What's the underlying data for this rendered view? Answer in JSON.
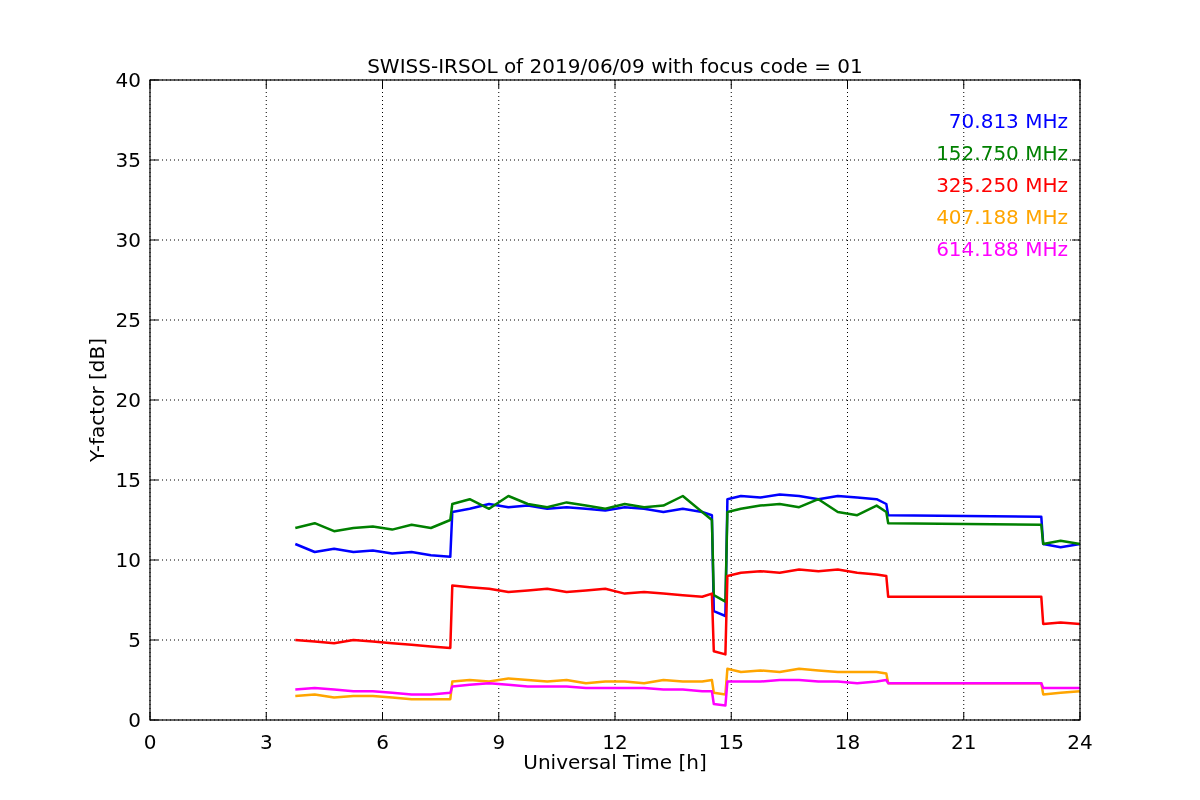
{
  "chart_data": {
    "type": "line",
    "title": "SWISS-IRSOL of 2019/06/09 with focus code = 01",
    "xlabel": "Universal Time [h]",
    "ylabel": "Y-factor [dB]",
    "x": [
      3.75,
      4.25,
      4.75,
      5.25,
      5.75,
      6.25,
      6.75,
      7.25,
      7.75,
      7.8,
      8.25,
      8.75,
      9.25,
      9.75,
      10.25,
      10.75,
      11.25,
      11.75,
      12.25,
      12.75,
      13.25,
      13.75,
      14.25,
      14.5,
      14.55,
      14.85,
      14.9,
      15.25,
      15.75,
      16.25,
      16.75,
      17.25,
      17.75,
      18.25,
      18.75,
      19.0,
      19.05,
      23.0,
      23.05,
      23.5,
      24
    ],
    "series": [
      {
        "name": "70.813 MHz",
        "color": "#0000ff",
        "values": [
          11,
          10.5,
          10.7,
          10.5,
          10.6,
          10.4,
          10.5,
          10.3,
          10.2,
          13,
          13.2,
          13.5,
          13.3,
          13.4,
          13.2,
          13.3,
          13.2,
          13.1,
          13.3,
          13.2,
          13,
          13.2,
          13,
          12.8,
          6.8,
          6.5,
          13.8,
          14,
          13.9,
          14.1,
          14,
          13.8,
          14,
          13.9,
          13.8,
          13.5,
          12.8,
          12.7,
          11,
          10.8,
          11
        ]
      },
      {
        "name": "152.750 MHz",
        "color": "#008000",
        "values": [
          12,
          12.3,
          11.8,
          12,
          12.1,
          11.9,
          12.2,
          12,
          12.5,
          13.5,
          13.8,
          13.2,
          14,
          13.5,
          13.3,
          13.6,
          13.4,
          13.2,
          13.5,
          13.3,
          13.4,
          14,
          13,
          12.5,
          7.8,
          7.4,
          13,
          13.2,
          13.4,
          13.5,
          13.3,
          13.8,
          13,
          12.8,
          13.4,
          13,
          12.3,
          12.2,
          11,
          11.2,
          11
        ]
      },
      {
        "name": "325.250 MHz",
        "color": "#ff0000",
        "values": [
          5,
          4.9,
          4.8,
          5,
          4.9,
          4.8,
          4.7,
          4.6,
          4.5,
          8.4,
          8.3,
          8.2,
          8,
          8.1,
          8.2,
          8,
          8.1,
          8.2,
          7.9,
          8,
          7.9,
          7.8,
          7.7,
          7.9,
          4.3,
          4.1,
          9,
          9.2,
          9.3,
          9.2,
          9.4,
          9.3,
          9.4,
          9.2,
          9.1,
          9,
          7.7,
          7.7,
          6,
          6.1,
          6
        ]
      },
      {
        "name": "407.188 MHz",
        "color": "#ffa500",
        "values": [
          1.5,
          1.6,
          1.4,
          1.5,
          1.5,
          1.4,
          1.3,
          1.3,
          1.3,
          2.4,
          2.5,
          2.4,
          2.6,
          2.5,
          2.4,
          2.5,
          2.3,
          2.4,
          2.4,
          2.3,
          2.5,
          2.4,
          2.4,
          2.5,
          1.7,
          1.6,
          3.2,
          3,
          3.1,
          3,
          3.2,
          3.1,
          3,
          3,
          3,
          2.9,
          2.3,
          2.3,
          1.6,
          1.7,
          1.8
        ]
      },
      {
        "name": "614.188 MHz",
        "color": "#ff00ff",
        "values": [
          1.9,
          2,
          1.9,
          1.8,
          1.8,
          1.7,
          1.6,
          1.6,
          1.7,
          2.1,
          2.2,
          2.3,
          2.2,
          2.1,
          2.1,
          2.1,
          2,
          2,
          2,
          2,
          1.9,
          1.9,
          1.8,
          1.8,
          1,
          0.9,
          2.4,
          2.4,
          2.4,
          2.5,
          2.5,
          2.4,
          2.4,
          2.3,
          2.4,
          2.5,
          2.3,
          2.3,
          2,
          2,
          2
        ]
      }
    ],
    "grid": true,
    "xlim": [
      0,
      24
    ],
    "ylim": [
      0,
      40
    ],
    "xticks": [
      0,
      3,
      6,
      9,
      12,
      15,
      18,
      21,
      24
    ],
    "yticks": [
      0,
      5,
      10,
      15,
      20,
      25,
      30,
      35,
      40
    ]
  }
}
